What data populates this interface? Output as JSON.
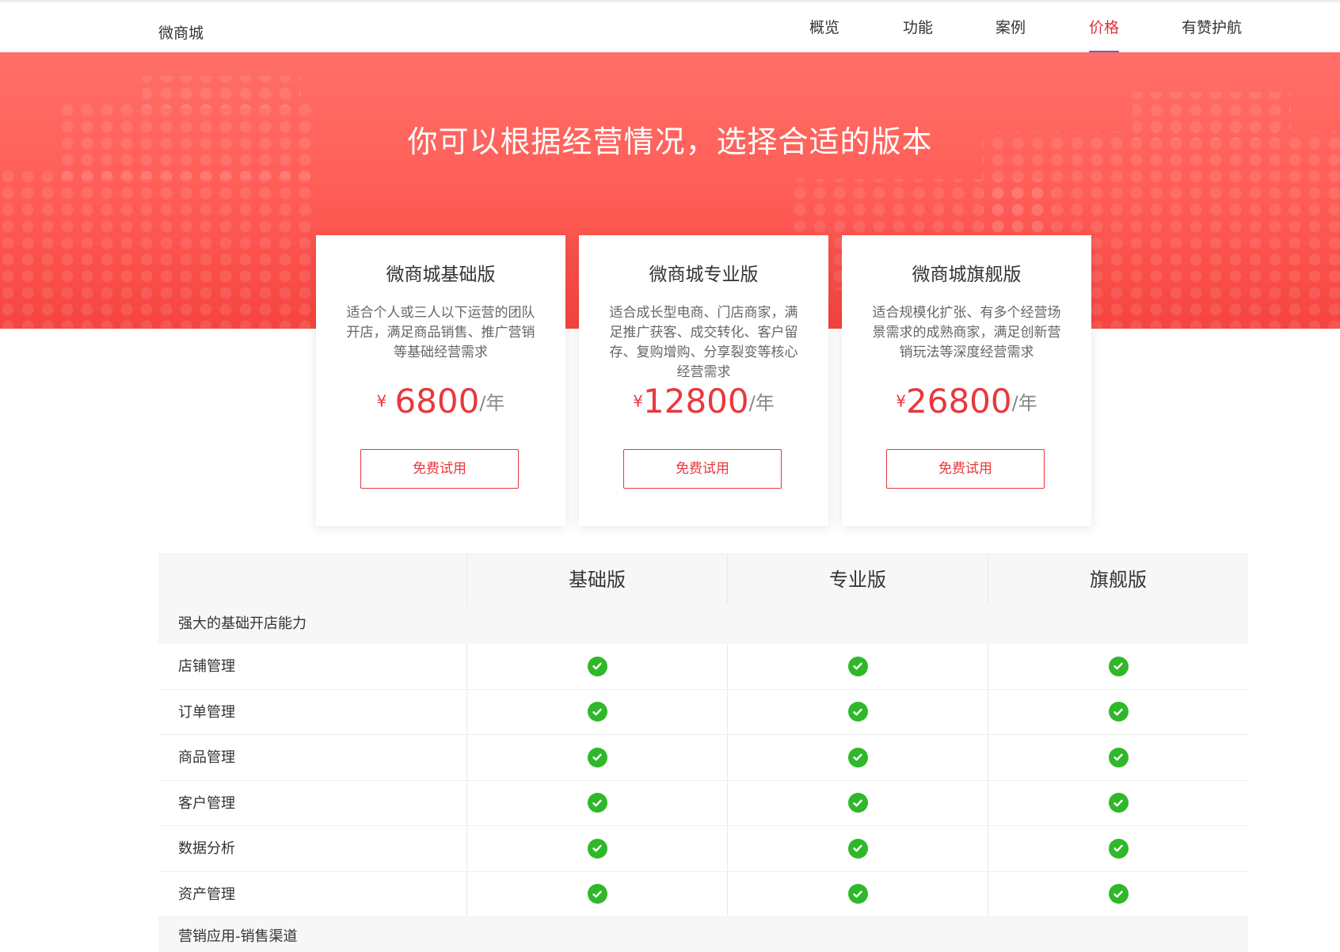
{
  "header": {
    "brand": "微商城",
    "nav": [
      "概览",
      "功能",
      "案例",
      "价格",
      "有赞护航"
    ],
    "active_nav": "价格"
  },
  "hero": {
    "title": "你可以根据经营情况，选择合适的版本"
  },
  "plans": [
    {
      "name": "微商城基础版",
      "desc": "适合个人或三人以下运营的团队开店，满足商品销售、推广营销等基础经营需求",
      "currency": "¥",
      "price": "6800",
      "per": "/年",
      "button": "免费试用"
    },
    {
      "name": "微商城专业版",
      "desc": "适合成长型电商、门店商家，满足推广获客、成交转化、客户留存、复购增购、分享裂变等核心经营需求",
      "currency": "¥",
      "price": "12800",
      "per": "/年",
      "button": "免费试用"
    },
    {
      "name": "微商城旗舰版",
      "desc": "适合规模化扩张、有多个经营场景需求的成熟商家，满足创新营销玩法等深度经营需求",
      "currency": "¥",
      "price": "26800",
      "per": "/年",
      "button": "免费试用"
    }
  ],
  "table": {
    "headers": [
      "",
      "基础版",
      "专业版",
      "旗舰版"
    ],
    "sections": [
      {
        "title": "强大的基础开店能力",
        "rows": [
          "店铺管理",
          "订单管理",
          "商品管理",
          "客户管理",
          "数据分析",
          "资产管理"
        ]
      },
      {
        "title": "营销应用-销售渠道",
        "rows": []
      }
    ],
    "included_icon": "check-circle-icon"
  },
  "colors": {
    "accent": "#e8383d",
    "hero_top": "#ff6f68",
    "hero_bottom": "#f6443f",
    "check": "#2fb82a",
    "nav_underline": "#6b5bd0"
  }
}
